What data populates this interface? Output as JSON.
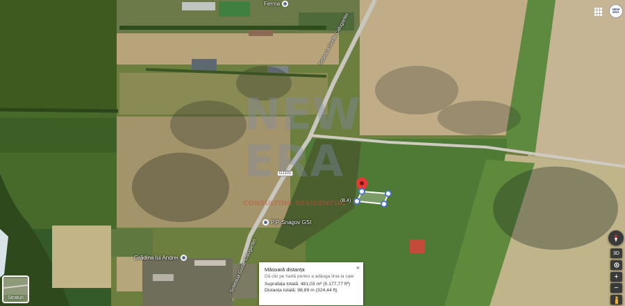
{
  "map": {
    "labels": {
      "ferma": "Ferma",
      "road_name_upper": "Soseaua Gurile Calugaritei",
      "road_name_lower": "Soseaua Gurile Calugaritei",
      "road_number": "DJ101",
      "poi_snagov": "P.P. Snagov GSI",
      "poi_gradina": "Grădina lui Andrei",
      "pin_label": "(B.4)"
    },
    "measure_card": {
      "title": "Măsoară distanța",
      "hint": "Dă clic pe hartă pentru a adăuga linia la cale",
      "area": "Suprafața totală: 481,03 m² (5.177,77 ft²)",
      "distance": "Distanța totală: 98,89 m (324,44 ft)",
      "close": "×"
    },
    "layers": {
      "label": "Straturi"
    },
    "controls": {
      "zoom_in": "+",
      "zoom_out": "−",
      "view_3d": "3D"
    },
    "watermark": {
      "line1": "NEW",
      "line2": "ERA",
      "line3": "CONSULTING RESIDENTIAL"
    },
    "brand_badge": "NEW ERA"
  }
}
